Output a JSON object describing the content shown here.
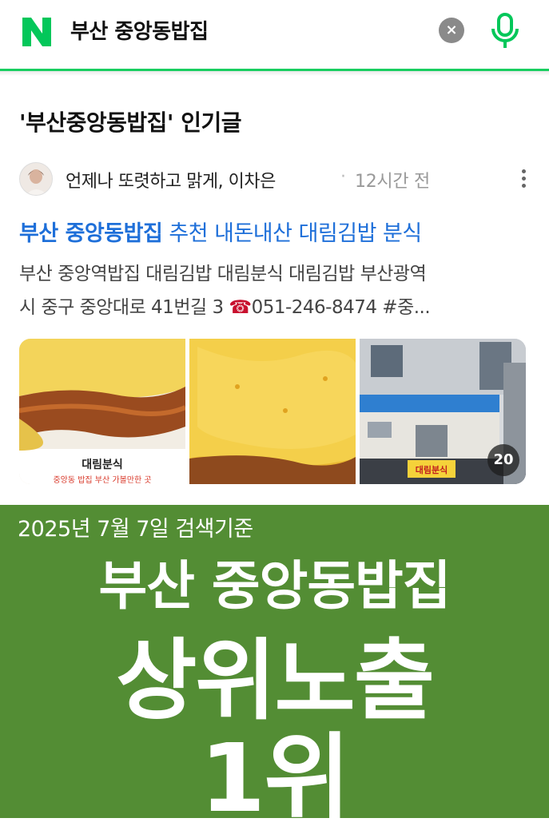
{
  "search": {
    "query": "부산 중앙동밥집",
    "logo_letter": "N",
    "clear_glyph": "×",
    "brand_color": "#03c75a"
  },
  "section": {
    "title": "'부산중앙동밥집' 인기글"
  },
  "post": {
    "author": "언제나 또렷하고 맑게, 이차은",
    "separator": "·",
    "time_ago": "12시간 전",
    "title_keyword": "부산 중앙동밥집",
    "title_rest": " 추천 내돈내산 대림김밥 분식",
    "snippet_line1": "부산 중앙역밥집 대림김밥 대림분식 대림김밥 부산광역",
    "snippet_line2_prefix": "시 중구 중앙대로 41번길 3 ",
    "phone_icon": "☎",
    "snippet_line2_suffix": "051-246-8474 #중...",
    "image_count": "20",
    "thumb1_caption": "대림분식",
    "thumb1_subcaption": "중앙동 밥집  부산 가볼만한 곳",
    "thumb3_sign": "대림분식"
  },
  "banner": {
    "date": "2025년 7월 7일 검색기준",
    "line1": "부산 중앙동밥집",
    "line2": "상위노출",
    "line3": "1위",
    "color": "#538d34"
  }
}
